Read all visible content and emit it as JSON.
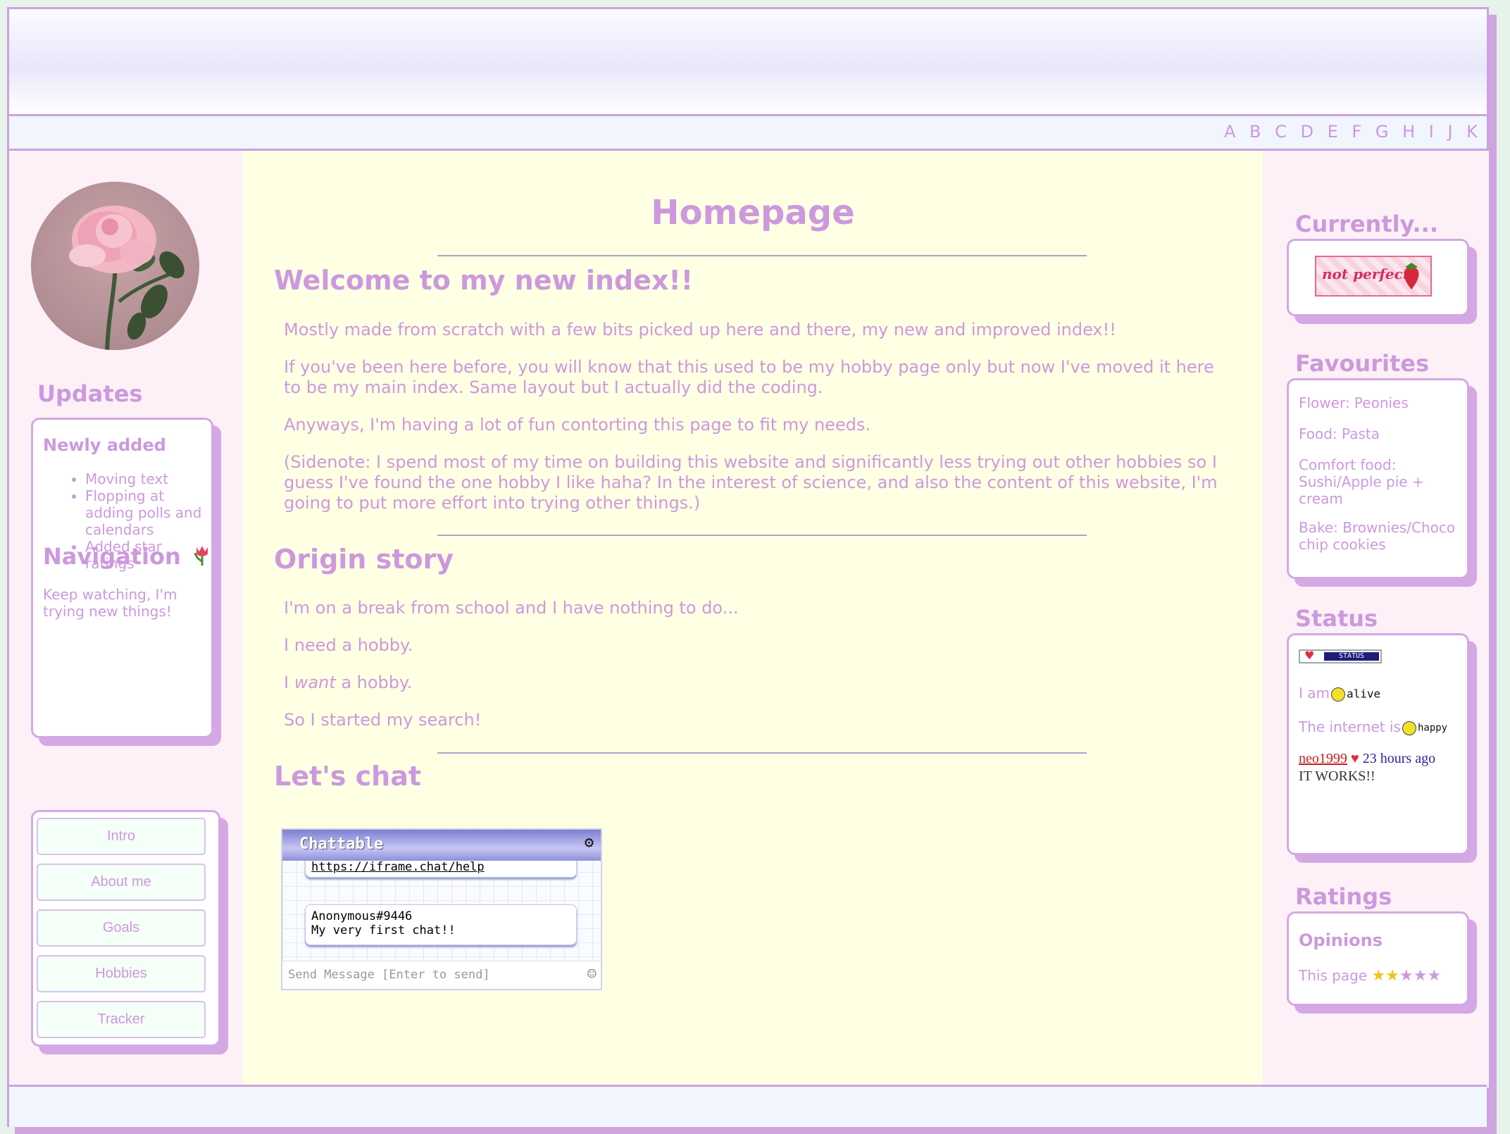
{
  "alphabet": "A B C D E F G H I J K L M N O P",
  "updates": {
    "heading": "Updates",
    "title": "Newly added",
    "items": [
      "Moving text",
      "Flopping at adding polls and calendars",
      "Added star ratings"
    ],
    "note": "Keep watching, I'm trying new things!"
  },
  "navigation": {
    "heading": "Navigation",
    "items": [
      "Intro",
      "About me",
      "Goals",
      "Hobbies",
      "Tracker"
    ]
  },
  "main": {
    "title": "Homepage",
    "welcome_heading": "Welcome to my new index!!",
    "welcome_paragraphs": [
      "Mostly made from scratch with a few bits picked up here and there, my new and improved index!!",
      "If you've been here before, you will know that this used to be my hobby page only but now I've moved it here to be my main index. Same layout but I actually did the coding.",
      "Anyways, I'm having a lot of fun contorting this page to fit my needs.",
      "(Sidenote: I spend most of my time on building this website and significantly less trying out other hobbies so I guess I've found the one hobby I like haha? In the interest of science, and also the content of this website, I'm going to put more effort into trying other things.)"
    ],
    "origin_heading": "Origin story",
    "origin_p1": "I'm on a break from school and I have nothing to do...",
    "origin_p2": "I need a hobby.",
    "origin_p3_pre": "I ",
    "origin_p3_em": "want",
    "origin_p3_post": " a hobby.",
    "origin_p4": "So I started my search!",
    "chat_heading": "Let's chat"
  },
  "chat": {
    "title": "Chattable",
    "help_link": "https://iframe.chat/help",
    "message_user": "Anonymous#9446",
    "message_text": "My very first chat!!",
    "input_placeholder": "Send Message [Enter to send]"
  },
  "currently": {
    "heading": "Currently...",
    "badge_text": "not perfect"
  },
  "favourites": {
    "heading": "Favourites",
    "items": [
      "Flower: Peonies",
      "Food: Pasta",
      "Comfort food: Sushi/Apple pie + cream",
      "Bake: Brownies/Choco chip cookies"
    ]
  },
  "status": {
    "heading": "Status",
    "badge_label": "STATUS",
    "i_am_label": "I am",
    "i_am_value": "alive",
    "internet_label": "The internet is",
    "internet_value": "happy",
    "post_user": "neo1999",
    "post_time": "23 hours ago",
    "post_text": "IT WORKS!!"
  },
  "ratings": {
    "heading": "Ratings",
    "title": "Opinions",
    "item_label": "This page",
    "stars_filled": 2,
    "stars_total": 5
  },
  "colors": {
    "accent": "#cc99dd",
    "border": "#cba3df",
    "center_bg": "#ffffe4",
    "side_bg": "#fdf0f6",
    "star_filled": "#f2c21c",
    "star_empty": "#cc99dd"
  }
}
